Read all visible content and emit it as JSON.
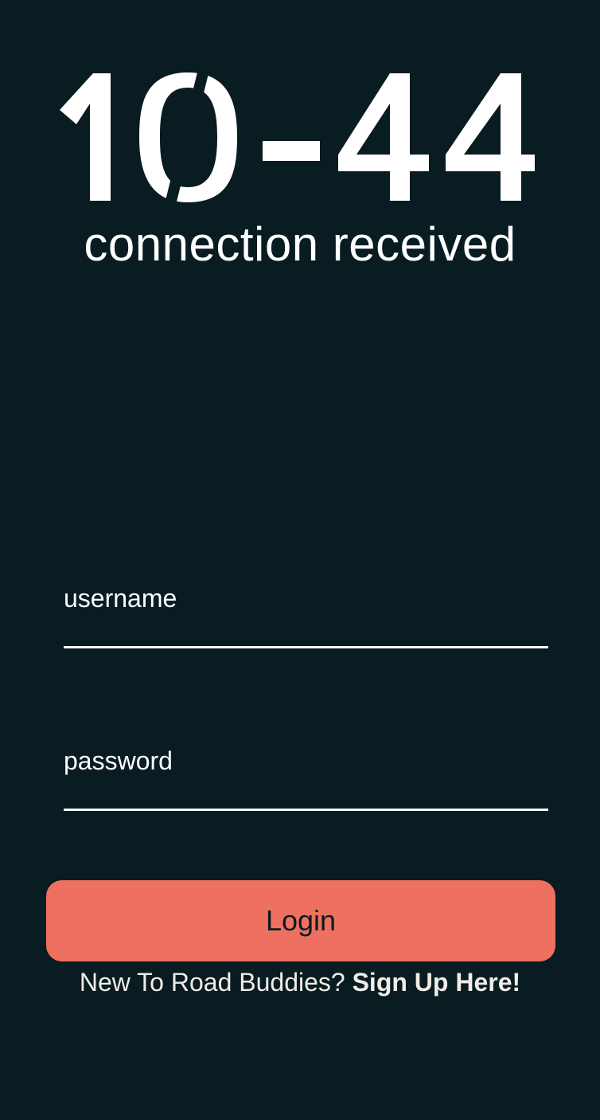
{
  "logo": {
    "text": "10-44"
  },
  "subtitle": "connection received",
  "form": {
    "username": {
      "label": "username",
      "value": ""
    },
    "password": {
      "label": "password",
      "value": ""
    },
    "login_label": "Login"
  },
  "signup": {
    "prompt": "New To Road Buddies?",
    "link_label": "Sign Up Here!"
  },
  "colors": {
    "background": "#081c22",
    "accent": "#ee7060",
    "text": "#ffffff",
    "signup_text": "#f2ece6"
  }
}
